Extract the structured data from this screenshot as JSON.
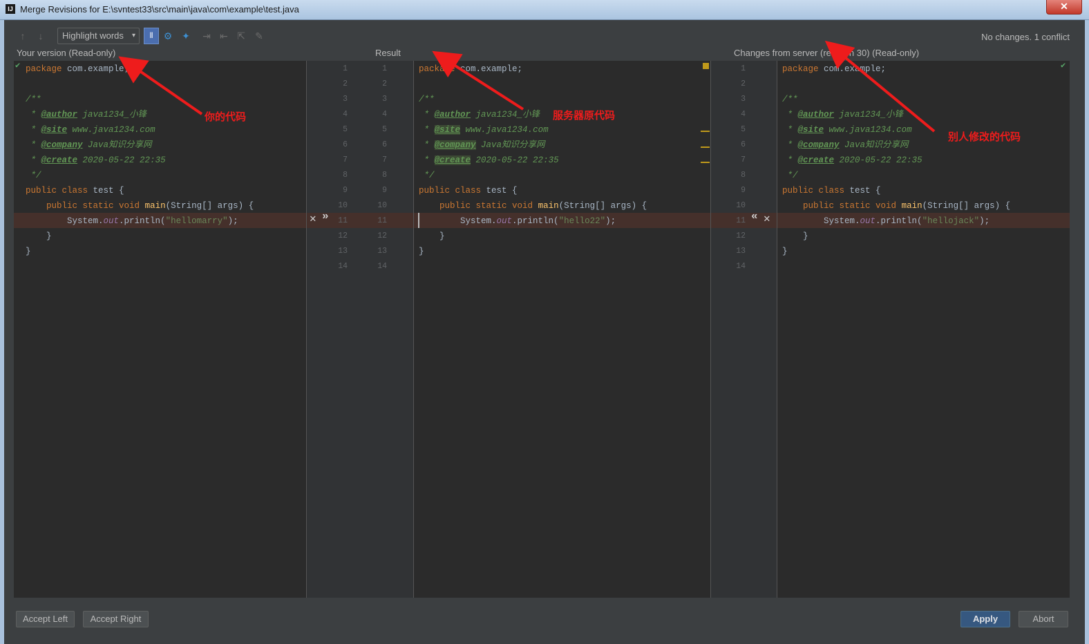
{
  "window": {
    "app_icon": "IJ",
    "title": "Merge Revisions for E:\\svntest33\\src\\main\\java\\com\\example\\test.java",
    "close_glyph": "✕"
  },
  "toolbar": {
    "prev_icon": "↑",
    "next_icon": "↓",
    "highlight_mode": "Highlight words",
    "dropdown_arrow": "▾",
    "toggle_glyph": "⫴",
    "settings_glyph": "⚙",
    "magic_glyph": "✦",
    "disabled_icons": [
      "⇥",
      "⇤",
      "⇱",
      "✎"
    ],
    "status": "No changes. 1 conflict"
  },
  "panes": {
    "left_title": "Your version (Read-only)",
    "center_title": "Result",
    "right_title": "Changes from server (revision 30) (Read-only)"
  },
  "code": {
    "package_kw": "package",
    "package_name": "com.example;",
    "doc_open": "/**",
    "author_tag": "@author",
    "author_val": "java1234_小锋",
    "site_tag": "@site",
    "site_val": "www.java1234.com",
    "company_tag": "@company",
    "company_val": "Java知识分享网",
    "create_tag": "@create",
    "create_val": "2020-05-22 22:35",
    "doc_close": "*/",
    "class_kw": "public class",
    "class_name": "test {",
    "method_kw": "public static void",
    "method_name": "main",
    "method_args": "(String[] args) {",
    "sysout_prefix": "System.",
    "sysout_field": "out",
    "sysout_call": ".println(",
    "close_inner": "}",
    "close_outer": "}",
    "left_string": "\"hellomarry\"",
    "center_string": "\"hello22\"",
    "right_string": "\"hellojack\"",
    "tail": ");"
  },
  "line_numbers": [
    "1",
    "2",
    "3",
    "4",
    "5",
    "6",
    "7",
    "8",
    "9",
    "10",
    "11",
    "12",
    "13",
    "14"
  ],
  "merge_actions": {
    "left_ignore": "✕",
    "left_apply": "»",
    "right_apply": "«",
    "right_ignore": "✕"
  },
  "annotations": {
    "yours": "你的代码",
    "server_original": "服务器原代码",
    "others": "别人修改的代码"
  },
  "buttons": {
    "accept_left": "Accept Left",
    "accept_right": "Accept Right",
    "apply": "Apply",
    "abort": "Abort"
  },
  "colors": {
    "conflict": "#45302b",
    "annotation": "#ee1c1c",
    "accent": "#365880"
  }
}
